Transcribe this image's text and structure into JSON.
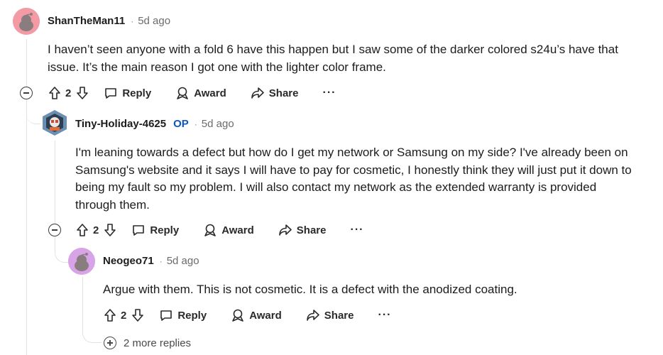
{
  "comments": [
    {
      "author": "ShanTheMan11",
      "op_badge": "",
      "separator": "·",
      "time": "5d ago",
      "body_lines": [
        "I haven’t seen anyone with a fold 6 have this happen but I saw some of the darker colored s24u’s have that",
        "issue. It’s the main reason I got one with the lighter color frame."
      ],
      "votes": "2",
      "reply_label": "Reply",
      "award_label": "Award",
      "share_label": "Share",
      "more_label": "···",
      "avatar_color": "#f39aa5"
    },
    {
      "author": "Tiny-Holiday-4625",
      "op_badge": "OP",
      "separator": "·",
      "time": "5d ago",
      "body_lines": [
        "I'm leaning towards a defect but how do I get my network or Samsung on my side? I've already been on",
        "Samsung's website and it says I will have to pay for cosmetic, I honestly think they will just put it down to",
        "being my fault so my problem. I will also contact my network as the extended warranty is provided",
        "through them."
      ],
      "votes": "2",
      "reply_label": "Reply",
      "award_label": "Award",
      "share_label": "Share",
      "more_label": "···",
      "avatar_color": "#6a8fb0"
    },
    {
      "author": "Neogeo71",
      "op_badge": "",
      "separator": "·",
      "time": "5d ago",
      "body_lines": [
        "Argue with them. This is not cosmetic. It is a defect with the anodized coating."
      ],
      "votes": "2",
      "reply_label": "Reply",
      "award_label": "Award",
      "share_label": "Share",
      "more_label": "···",
      "avatar_color": "#d9a3e8"
    }
  ],
  "more_replies_label": "2 more replies",
  "colors": {
    "op": "#0a56c5",
    "thread_line": "#e0e3e6",
    "text": "#1c1c1c",
    "muted": "#6b6b6b"
  },
  "icons": [
    "upvote-icon",
    "downvote-icon",
    "reply-bubble-icon",
    "award-icon",
    "share-arrow-icon",
    "collapse-icon",
    "expand-plus-icon",
    "more-options-icon"
  ]
}
